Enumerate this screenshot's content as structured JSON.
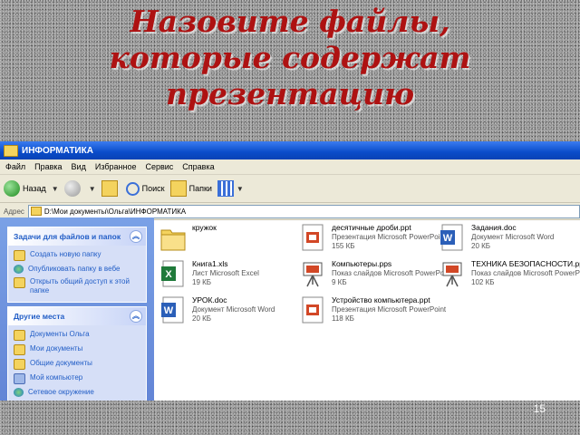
{
  "slide": {
    "title_lines": [
      "Назовите файлы,",
      "которые содержат",
      "презентацию"
    ],
    "page_number": "15"
  },
  "window": {
    "title": "ИНФОРМАТИКА",
    "menu": [
      "Файл",
      "Правка",
      "Вид",
      "Избранное",
      "Сервис",
      "Справка"
    ],
    "toolbar": {
      "back": "Назад",
      "search": "Поиск",
      "folders": "Папки"
    },
    "address_label": "Адрес",
    "address_value": "D:\\Мои документы\\Ольга\\ИНФОРМАТИКА"
  },
  "taskpane": {
    "file_tasks": {
      "title": "Задачи для файлов и папок",
      "items": [
        "Создать новую папку",
        "Опубликовать папку в вебе",
        "Открыть общий доступ к этой папке"
      ]
    },
    "other_places": {
      "title": "Другие места",
      "items": [
        "Документы Ольга",
        "Мои документы",
        "Общие документы",
        "Мой компьютер",
        "Сетевое окружение"
      ]
    }
  },
  "files": [
    {
      "name": "кружок",
      "type": "",
      "size": "",
      "icon": "folder-icon"
    },
    {
      "name": "десятичные дроби.ppt",
      "type": "Презентация Microsoft PowerPoint",
      "size": "155 КБ",
      "icon": "powerpoint-icon"
    },
    {
      "name": "Задания.doc",
      "type": "Документ Microsoft Word",
      "size": "20 КБ",
      "icon": "word-icon"
    },
    {
      "name": "Книга1.xls",
      "type": "Лист Microsoft Excel",
      "size": "19 КБ",
      "icon": "excel-icon"
    },
    {
      "name": "Компьютеры.pps",
      "type": "Показ слайдов Microsoft PowerPoint",
      "size": "9 КБ",
      "icon": "slideshow-icon"
    },
    {
      "name": "ТЕХНИКА БЕЗОПАСНОСТИ.pps",
      "type": "Показ слайдов Microsoft PowerPoint",
      "size": "102 КБ",
      "icon": "slideshow-icon"
    },
    {
      "name": "УРОК.doc",
      "type": "Документ Microsoft Word",
      "size": "20 КБ",
      "icon": "word-icon"
    },
    {
      "name": "Устройство компьютера.ppt",
      "type": "Презентация Microsoft PowerPoint",
      "size": "118 КБ",
      "icon": "powerpoint-icon"
    }
  ],
  "colors": {
    "title": "#ae1212",
    "xp_blue": "#0a4cc9",
    "taskpane": "#6b8ee0"
  }
}
